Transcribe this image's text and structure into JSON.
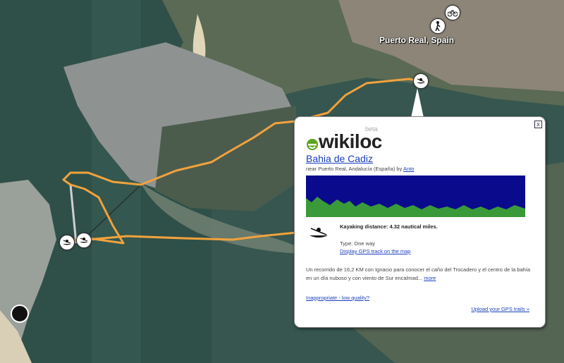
{
  "map": {
    "place_label": "Puerto Real, Spain",
    "route_color": "#f2a23c"
  },
  "balloon": {
    "close_label": "x",
    "logo": {
      "text": "wikiloc",
      "beta": "beta",
      "accent_color": "#5aa51d"
    },
    "title": "Bahia de Cadiz",
    "byline_prefix": "near Puerto Real, Andalucía (España) by ",
    "author": "Anto",
    "activity_icon": "kayak-icon",
    "distance": "Kayaking distance: 4.32 nautical miles.",
    "type": "Type: One way",
    "display_link": "Display GPS track on the map",
    "description": "Un recorrido de 16,2 KM con Ignacio para conocer el caño del Trocadero y el centro de la bahía en un día nuboso y con viento de Sur encalmad...",
    "more_link": "more",
    "inappropriate_link": "Inappropriate - low quality?",
    "upload_link": "Upload your GPS trails »",
    "profile_colors": {
      "sky": "#0a0a8c",
      "ground": "#3a9a3a"
    }
  }
}
